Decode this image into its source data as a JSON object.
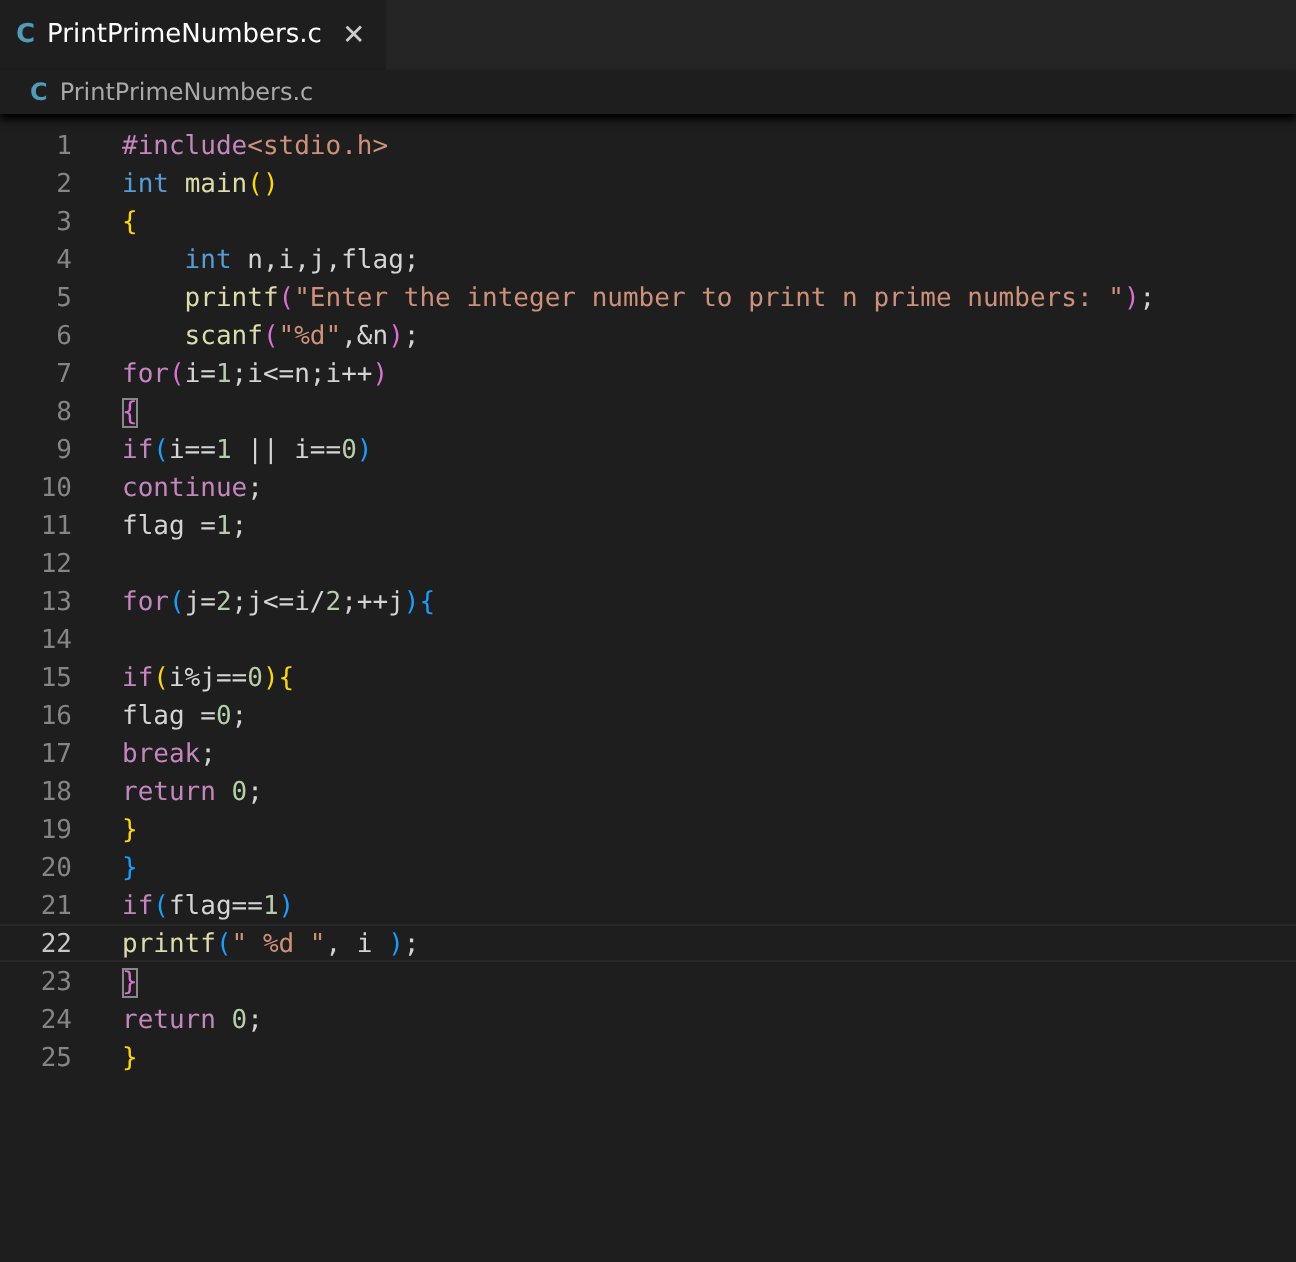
{
  "tabs": [
    {
      "icon": "C",
      "label": "PrintPrimeNumbers.c",
      "selected": true,
      "close": "✕"
    }
  ],
  "breadcrumb": {
    "icon": "C",
    "label": "PrintPrimeNumbers.c"
  },
  "lines": [
    {
      "number": "1",
      "current": false,
      "tokens": [
        {
          "text": "#include",
          "kind": "kw"
        },
        {
          "text": "<stdio.h>",
          "kind": "str"
        }
      ]
    },
    {
      "number": "2",
      "current": false,
      "tokens": [
        {
          "text": "int ",
          "kind": "type"
        },
        {
          "text": "main",
          "kind": "fn"
        },
        {
          "text": "()",
          "kind": "b1"
        }
      ]
    },
    {
      "number": "3",
      "current": false,
      "tokens": [
        {
          "text": "{",
          "kind": "b1"
        }
      ]
    },
    {
      "number": "4",
      "current": false,
      "tokens": [
        {
          "text": "    int",
          "kind": "type"
        },
        {
          "text": " n,i,j,flag;",
          "kind": "plain"
        }
      ]
    },
    {
      "number": "5",
      "current": false,
      "tokens": [
        {
          "text": "    printf",
          "kind": "fn"
        },
        {
          "text": "(",
          "kind": "b2"
        },
        {
          "text": "\"Enter the integer number to print n prime numbers: \"",
          "kind": "str"
        },
        {
          "text": ")",
          "kind": "b2"
        },
        {
          "text": ";",
          "kind": "plain"
        }
      ]
    },
    {
      "number": "6",
      "current": false,
      "tokens": [
        {
          "text": "    scanf",
          "kind": "fn"
        },
        {
          "text": "(",
          "kind": "b2"
        },
        {
          "text": "\"%d\"",
          "kind": "str"
        },
        {
          "text": ",&n",
          "kind": "plain"
        },
        {
          "text": ")",
          "kind": "b2"
        },
        {
          "text": ";",
          "kind": "plain"
        }
      ]
    },
    {
      "number": "7",
      "current": false,
      "tokens": [
        {
          "text": "for",
          "kind": "kw"
        },
        {
          "text": "(",
          "kind": "b2"
        },
        {
          "text": "i=",
          "kind": "plain"
        },
        {
          "text": "1",
          "kind": "num"
        },
        {
          "text": ";i<=n;i++",
          "kind": "plain"
        },
        {
          "text": ")",
          "kind": "b2"
        }
      ]
    },
    {
      "number": "8",
      "current": false,
      "tokens": [
        {
          "text": "{",
          "kind": "b2",
          "matched": true
        }
      ]
    },
    {
      "number": "9",
      "current": false,
      "tokens": [
        {
          "text": "if",
          "kind": "kw"
        },
        {
          "text": "(",
          "kind": "b3"
        },
        {
          "text": "i==",
          "kind": "plain"
        },
        {
          "text": "1",
          "kind": "num"
        },
        {
          "text": " || i==",
          "kind": "plain"
        },
        {
          "text": "0",
          "kind": "num"
        },
        {
          "text": ")",
          "kind": "b3"
        }
      ]
    },
    {
      "number": "10",
      "current": false,
      "tokens": [
        {
          "text": "continue",
          "kind": "kw"
        },
        {
          "text": ";",
          "kind": "plain"
        }
      ]
    },
    {
      "number": "11",
      "current": false,
      "tokens": [
        {
          "text": "flag =",
          "kind": "plain"
        },
        {
          "text": "1",
          "kind": "num"
        },
        {
          "text": ";",
          "kind": "plain"
        }
      ]
    },
    {
      "number": "12",
      "current": false
    },
    {
      "number": "13",
      "current": false,
      "tokens": [
        {
          "text": "for",
          "kind": "kw"
        },
        {
          "text": "(",
          "kind": "b3"
        },
        {
          "text": "j=",
          "kind": "plain"
        },
        {
          "text": "2",
          "kind": "num"
        },
        {
          "text": ";j<=i/",
          "kind": "plain"
        },
        {
          "text": "2",
          "kind": "num"
        },
        {
          "text": ";++j",
          "kind": "plain"
        },
        {
          "text": "){",
          "kind": "b3"
        }
      ]
    },
    {
      "number": "14",
      "current": false
    },
    {
      "number": "15",
      "current": false,
      "tokens": [
        {
          "text": "if",
          "kind": "kw"
        },
        {
          "text": "(",
          "kind": "b1"
        },
        {
          "text": "i%j==",
          "kind": "plain"
        },
        {
          "text": "0",
          "kind": "num"
        },
        {
          "text": "){",
          "kind": "b1"
        }
      ]
    },
    {
      "number": "16",
      "current": false,
      "tokens": [
        {
          "text": "flag =",
          "kind": "plain"
        },
        {
          "text": "0",
          "kind": "num"
        },
        {
          "text": ";",
          "kind": "plain"
        }
      ]
    },
    {
      "number": "17",
      "current": false,
      "tokens": [
        {
          "text": "break",
          "kind": "kw"
        },
        {
          "text": ";",
          "kind": "plain"
        }
      ]
    },
    {
      "number": "18",
      "current": false,
      "tokens": [
        {
          "text": "return ",
          "kind": "kw"
        },
        {
          "text": "0",
          "kind": "num"
        },
        {
          "text": ";",
          "kind": "plain"
        }
      ]
    },
    {
      "number": "19",
      "current": false,
      "tokens": [
        {
          "text": "}",
          "kind": "b1"
        }
      ]
    },
    {
      "number": "20",
      "current": false,
      "tokens": [
        {
          "text": "}",
          "kind": "b3"
        }
      ]
    },
    {
      "number": "21",
      "current": false,
      "tokens": [
        {
          "text": "if",
          "kind": "kw"
        },
        {
          "text": "(",
          "kind": "b3"
        },
        {
          "text": "flag==",
          "kind": "plain"
        },
        {
          "text": "1",
          "kind": "num"
        },
        {
          "text": ")",
          "kind": "b3"
        }
      ]
    },
    {
      "number": "22",
      "current": true,
      "tokens": [
        {
          "text": "printf",
          "kind": "fn"
        },
        {
          "text": "(",
          "kind": "b3"
        },
        {
          "text": "\" %d \"",
          "kind": "str"
        },
        {
          "text": ", i ",
          "kind": "plain"
        },
        {
          "text": ")",
          "kind": "b3"
        },
        {
          "text": ";",
          "kind": "plain"
        }
      ]
    },
    {
      "number": "23",
      "current": false,
      "tokens": [
        {
          "text": "}",
          "kind": "b2",
          "matched": true
        }
      ]
    },
    {
      "number": "24",
      "current": false,
      "tokens": [
        {
          "text": "return ",
          "kind": "kw"
        },
        {
          "text": "0",
          "kind": "num"
        },
        {
          "text": ";",
          "kind": "plain"
        }
      ]
    },
    {
      "number": "25",
      "current": false,
      "tokens": [
        {
          "text": "}",
          "kind": "b1"
        }
      ]
    }
  ]
}
